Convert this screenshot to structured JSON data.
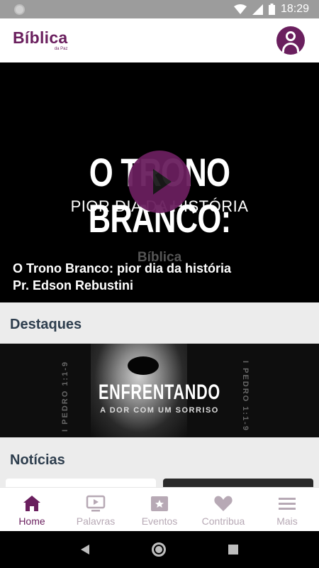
{
  "status": {
    "time": "18:29"
  },
  "app": {
    "logo_text": "Bíblica",
    "logo_subtext": "da Paz"
  },
  "hero": {
    "video_title_big": "O TRONO BRANCO:",
    "video_subtitle": "PIOR DIA DA HISTÓRIA",
    "watermark": "Bíblica",
    "caption_title": "O Trono Branco: pior dia da história",
    "caption_author": "Pr. Edson Rebustini"
  },
  "destaques": {
    "title": "Destaques",
    "feature_title": "ENFRENTANDO",
    "feature_subtitle": "A DOR COM UM SORRISO",
    "side_text": "I PEDRO 1:1-9"
  },
  "noticias": {
    "title": "Notícias"
  },
  "bottom_nav": {
    "items": [
      {
        "label": "Home",
        "icon": "home-icon"
      },
      {
        "label": "Palavras",
        "icon": "video-icon"
      },
      {
        "label": "Eventos",
        "icon": "events-icon"
      },
      {
        "label": "Contribua",
        "icon": "heart-icon"
      },
      {
        "label": "Mais",
        "icon": "menu-icon"
      }
    ]
  },
  "colors": {
    "brand": "#6a1f5e",
    "inactive": "#b7a9b5",
    "heading": "#2e3e4e"
  }
}
